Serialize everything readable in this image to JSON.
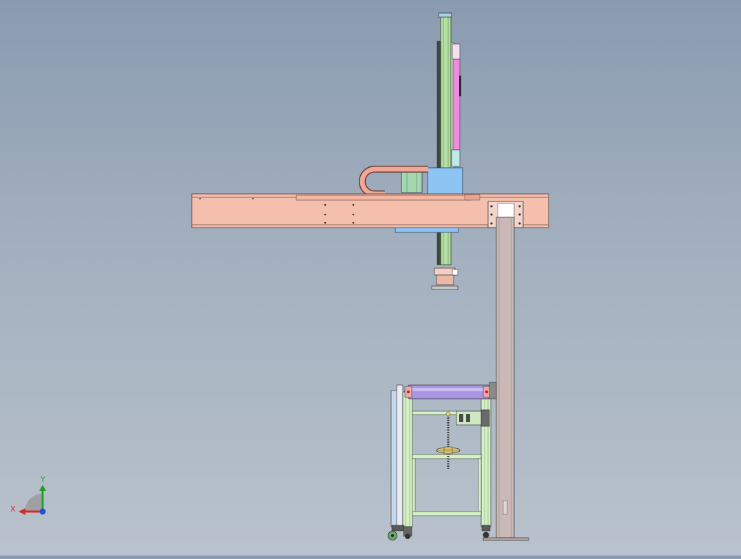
{
  "triad": {
    "x_label": "X",
    "y_label": "Y",
    "x_color": "#d8282a",
    "y_color": "#1fa02a",
    "z_color": "#2050d8"
  },
  "colors": {
    "beam": "#f4c0ad",
    "beam_edge": "#6a4b45",
    "column": "#c9b8b5",
    "rail_green": "#b5e0a3",
    "rail_magenta": "#f08ae0",
    "carriage_blue": "#8cc4f4",
    "roller_purple": "#a995e3",
    "frame_green": "#d4f0c5",
    "frame_blue": "#c5d8ee"
  }
}
